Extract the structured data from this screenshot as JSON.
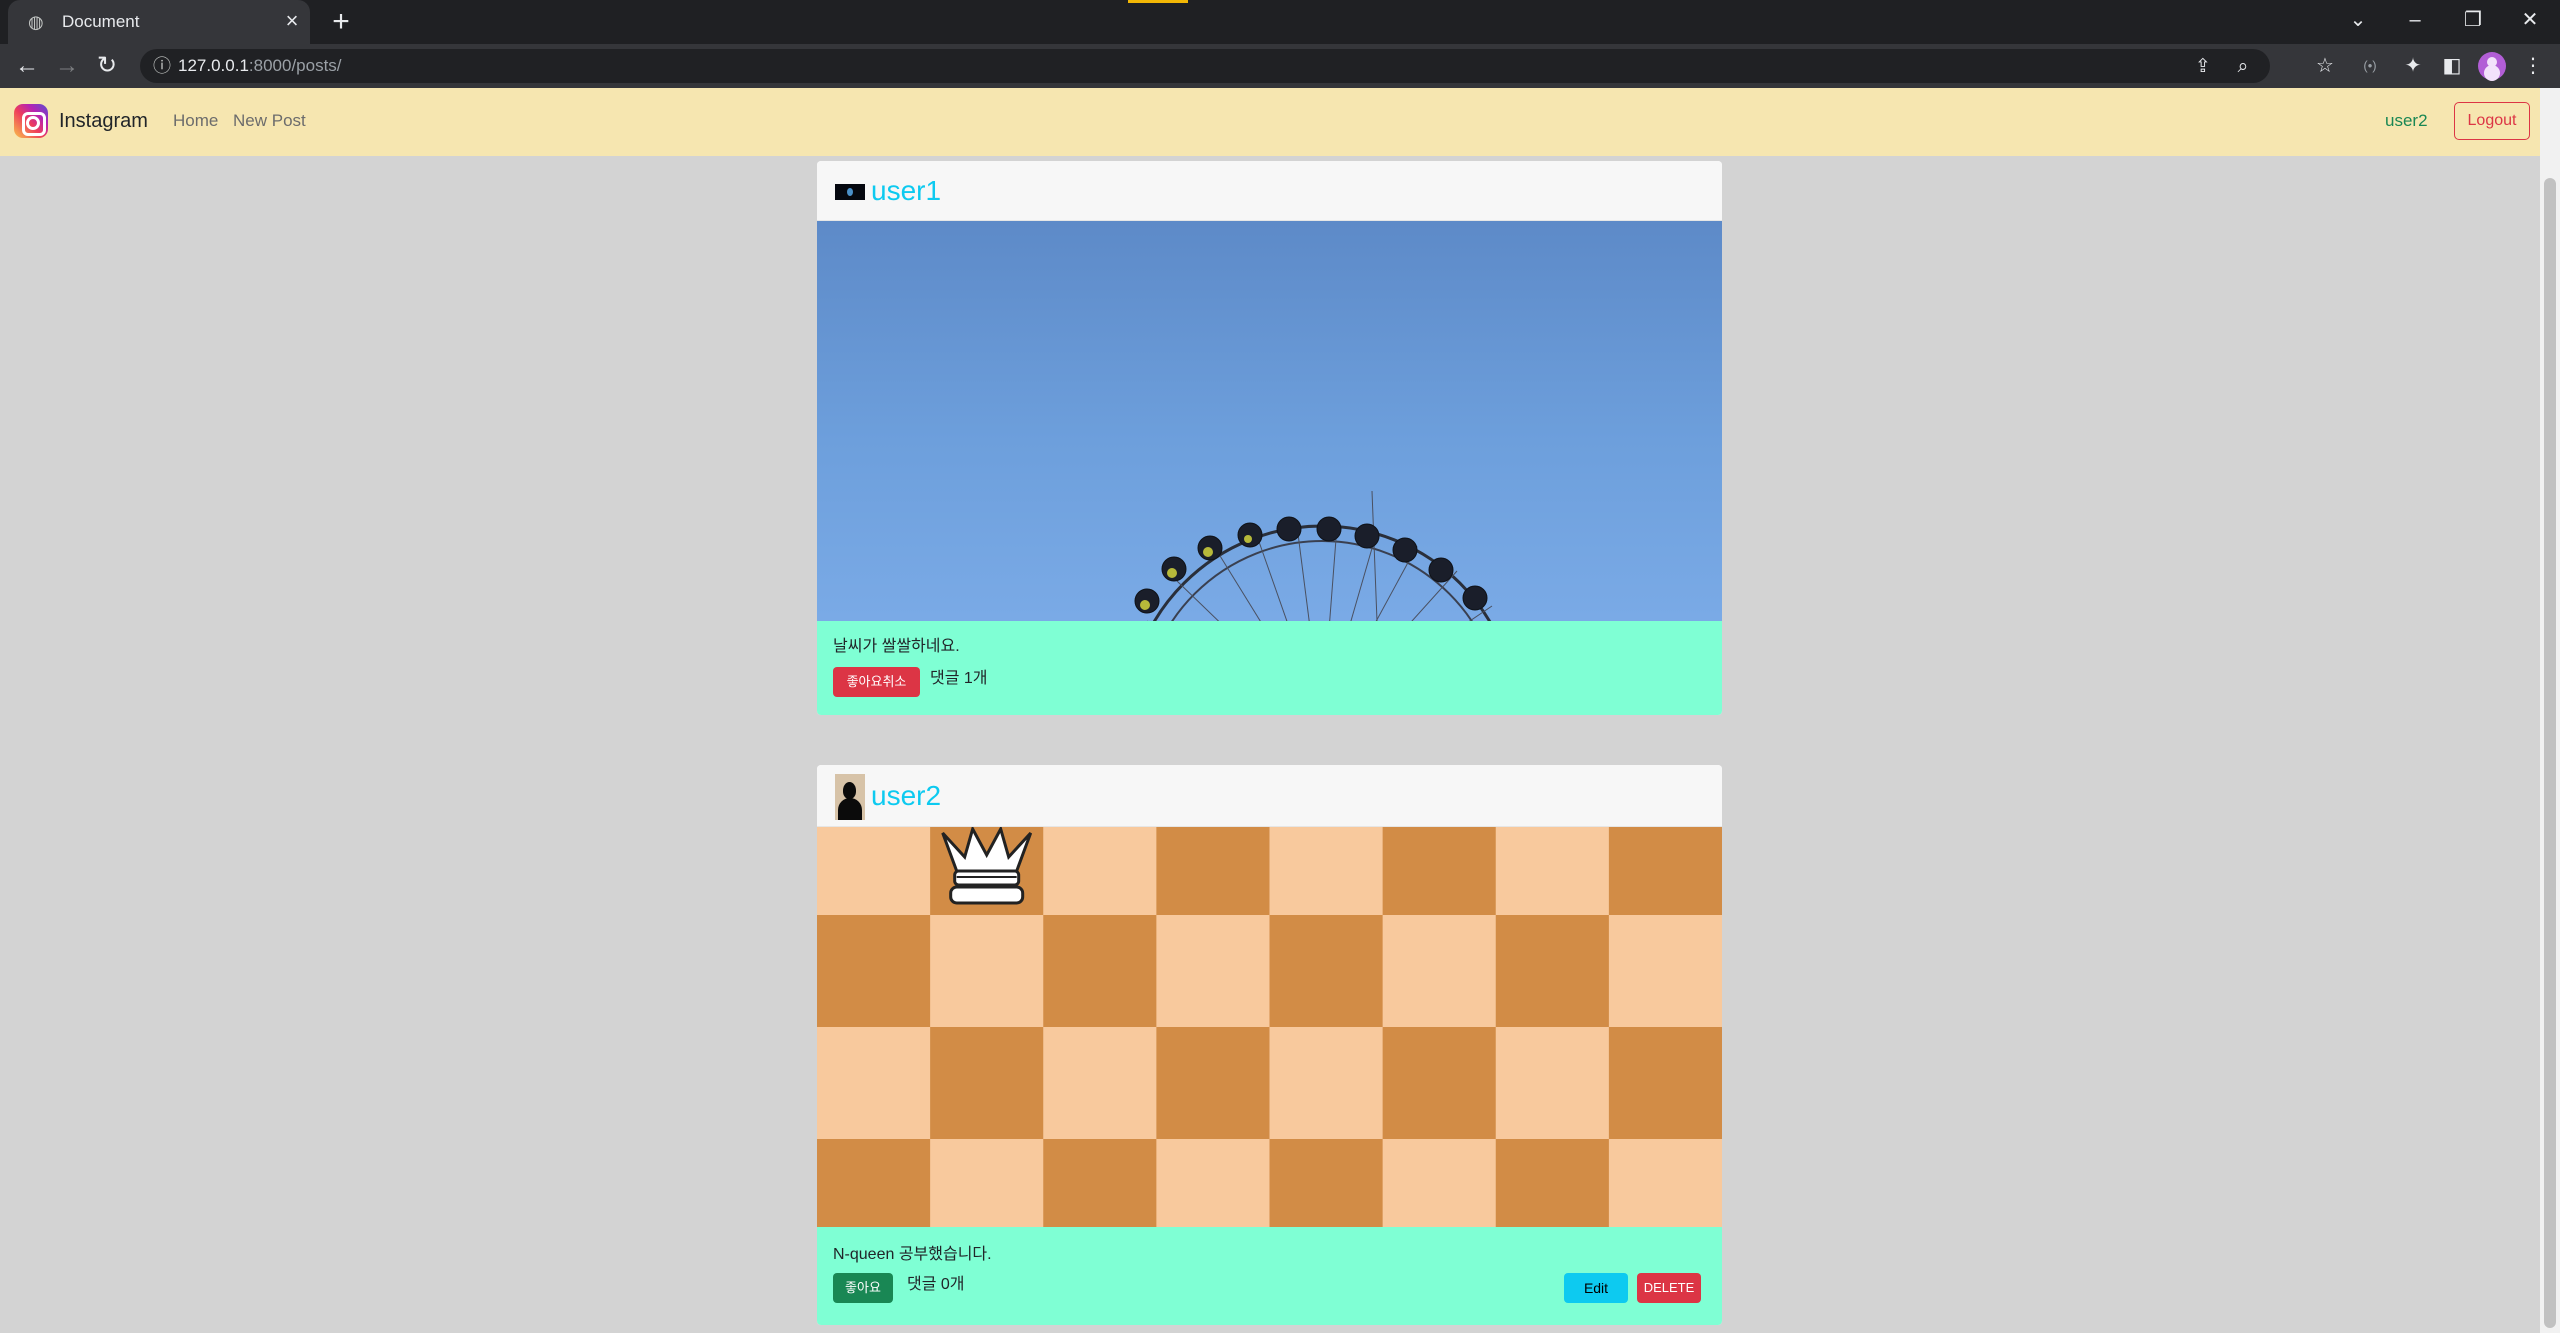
{
  "browser": {
    "tab_title": "Document",
    "url_host": "127.0.0.1",
    "url_rest": ":8000/posts/"
  },
  "navbar": {
    "brand": "Instagram",
    "links": [
      "Home",
      "New Post"
    ],
    "username": "user2",
    "logout_label": "Logout"
  },
  "posts": [
    {
      "author": "user1",
      "image_description": "ferris-wheel-sky",
      "caption": "날씨가 쌀쌀하네요.",
      "like_label": "좋아요취소",
      "liked": true,
      "comments_label": "댓글 1개",
      "can_edit": false
    },
    {
      "author": "user2",
      "image_description": "chessboard-queen",
      "caption": "N-queen 공부했습니다.",
      "like_label": "좋아요",
      "liked": false,
      "comments_label": "댓글 0개",
      "can_edit": true,
      "edit_label": "Edit",
      "delete_label": "DELETE"
    }
  ],
  "colors": {
    "navbar_bg": "#f6e6b0",
    "page_bg": "#d3d3d3",
    "footer_bg": "#7fffd4",
    "username": "#0dcaf0",
    "unlike_btn": "#dc3545",
    "like_btn": "#198754",
    "board_light": "#f8c99d",
    "board_dark": "#d28c46"
  }
}
